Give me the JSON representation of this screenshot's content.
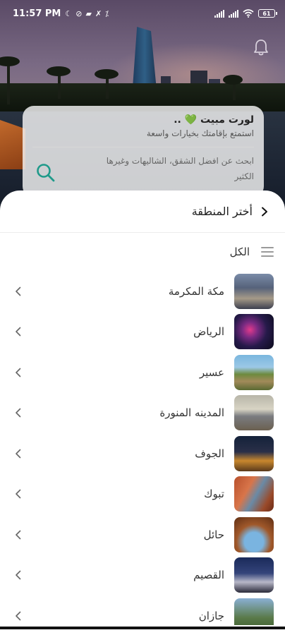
{
  "status_bar": {
    "time": "11:57 PM",
    "battery": "61"
  },
  "hero": {
    "notification_icon": "bell-icon"
  },
  "search_card": {
    "title": "لورت مبيت 💚 ..",
    "subtitle": "استمتع بإقامتك بخيارات واسعة",
    "description": "ابحث عن افضل الشقق، الشاليهات وغيرها الكثير",
    "search_icon": "search-icon"
  },
  "sheet": {
    "title": "أختر المنطقة",
    "all_label": "الكل",
    "regions": [
      {
        "label": "مكة المكرمة",
        "thumb": "makkah"
      },
      {
        "label": "الرياض",
        "thumb": "riyadh"
      },
      {
        "label": "عسير",
        "thumb": "asir"
      },
      {
        "label": "المدينه المنورة",
        "thumb": "madinah"
      },
      {
        "label": "الجوف",
        "thumb": "jouf"
      },
      {
        "label": "تبوك",
        "thumb": "tabuk"
      },
      {
        "label": "حائل",
        "thumb": "hail"
      },
      {
        "label": "القصيم",
        "thumb": "qassim"
      },
      {
        "label": "جازان",
        "thumb": "jazan"
      }
    ]
  },
  "colors": {
    "accent_teal": "#1f9a8a",
    "sheet_bg": "#ffffff",
    "text_primary": "#222222"
  }
}
